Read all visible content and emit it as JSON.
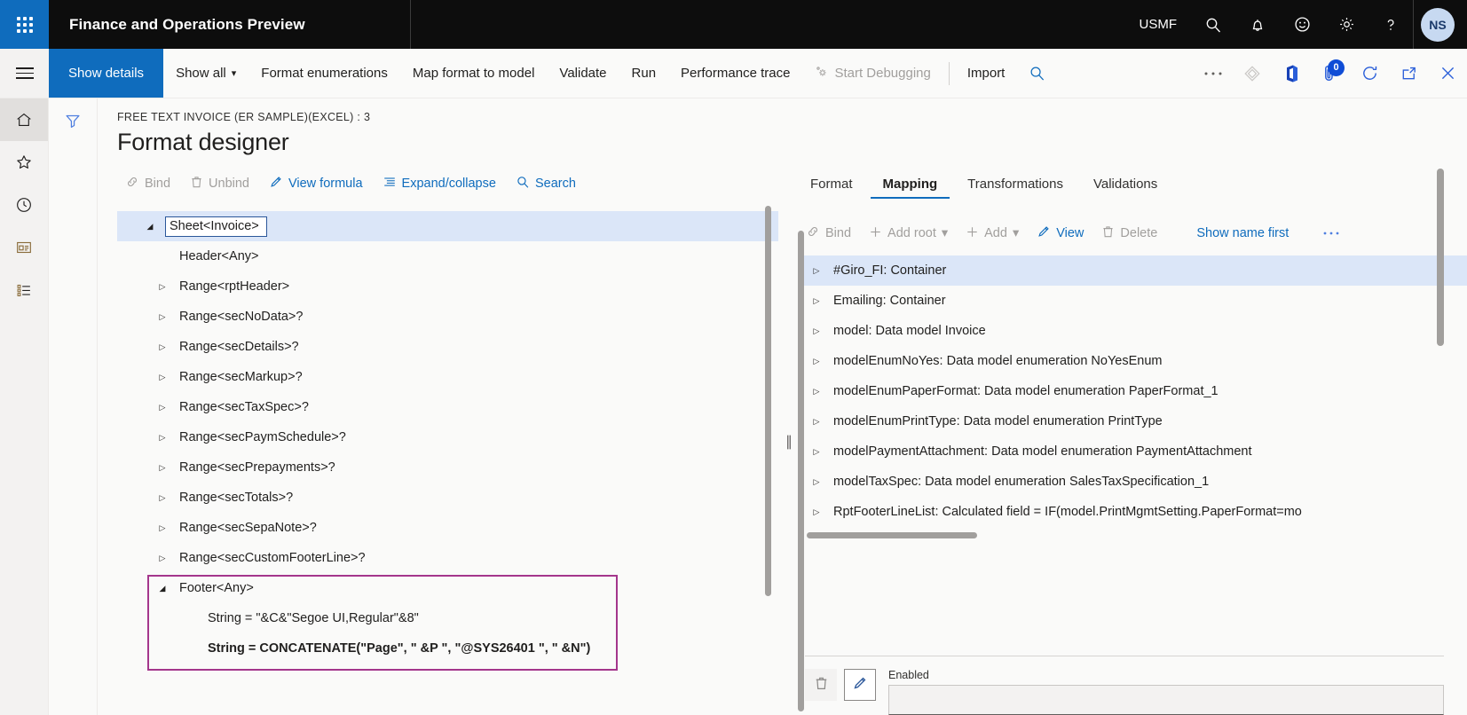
{
  "navbar": {
    "waffle_icon": "app-launcher-icon",
    "app_title": "Finance and Operations Preview",
    "company": "USMF",
    "icons": [
      "search-icon",
      "bell-icon",
      "feedback-smiley-icon",
      "gear-icon",
      "help-question-icon"
    ],
    "avatar_initials": "NS",
    "accent": "#0f6cbd",
    "bar_bg": "#0d0d0d"
  },
  "actionpane": {
    "hamburger_icon": "hamburger-menu-icon",
    "active_tab": "Show details",
    "items": [
      {
        "label": "Show all",
        "icon": "",
        "chevron": "⌵",
        "disabled": false
      },
      {
        "label": "Format enumerations",
        "icon": "",
        "chevron": "",
        "disabled": false
      },
      {
        "label": "Map format to model",
        "icon": "",
        "chevron": "",
        "disabled": false
      },
      {
        "label": "Validate",
        "icon": "",
        "chevron": "",
        "disabled": false
      },
      {
        "label": "Run",
        "icon": "",
        "chevron": "",
        "disabled": false
      },
      {
        "label": "Performance trace",
        "icon": "",
        "chevron": "",
        "disabled": false
      },
      {
        "label": "Start Debugging",
        "icon": "debug-gear-icon",
        "chevron": "",
        "disabled": true
      },
      {
        "label": "Import",
        "icon": "",
        "chevron": "",
        "disabled": false
      }
    ],
    "right_icons": [
      "search-icon",
      "ellipsis-icon",
      "diamond-lifecycle-icon",
      "office-icon",
      "attachment-icon",
      "refresh-icon",
      "open-in-new-window-icon",
      "close-icon"
    ],
    "attachment_badge": "0"
  },
  "railbar": {
    "items": [
      "home-icon",
      "favorites-star-icon",
      "recent-clock-icon",
      "workspaces-icon",
      "modules-list-icon"
    ]
  },
  "filterbar": {
    "icon": "filter-funnel-icon"
  },
  "header": {
    "breadcrumb": "FREE TEXT INVOICE (ER SAMPLE)(EXCEL) : 3",
    "title": "Format designer"
  },
  "left_pane": {
    "toolbar": [
      {
        "label": "Bind",
        "icon": "bind-link-icon",
        "disabled": true
      },
      {
        "label": "Unbind",
        "icon": "trash-icon",
        "disabled": true
      },
      {
        "label": "View formula",
        "icon": "pencil-icon",
        "disabled": false
      },
      {
        "label": "Expand/collapse",
        "icon": "list-lines-icon",
        "disabled": false
      },
      {
        "label": "Search",
        "icon": "search-icon",
        "disabled": false
      }
    ],
    "tree": [
      {
        "label": "Sheet<Invoice>",
        "twisty": "expanded",
        "indent": 0,
        "selected": true,
        "boxed": true,
        "bold": false
      },
      {
        "label": "Header<Any>",
        "twisty": "none",
        "indent": 1,
        "selected": false,
        "boxed": false,
        "bold": false
      },
      {
        "label": "Range<rptHeader>",
        "twisty": "collapsed",
        "indent": 1,
        "selected": false,
        "boxed": false,
        "bold": false
      },
      {
        "label": "Range<secNoData>?",
        "twisty": "collapsed",
        "indent": 1,
        "selected": false,
        "boxed": false,
        "bold": false
      },
      {
        "label": "Range<secDetails>?",
        "twisty": "collapsed",
        "indent": 1,
        "selected": false,
        "boxed": false,
        "bold": false
      },
      {
        "label": "Range<secMarkup>?",
        "twisty": "collapsed",
        "indent": 1,
        "selected": false,
        "boxed": false,
        "bold": false
      },
      {
        "label": "Range<secTaxSpec>?",
        "twisty": "collapsed",
        "indent": 1,
        "selected": false,
        "boxed": false,
        "bold": false
      },
      {
        "label": "Range<secPaymSchedule>?",
        "twisty": "collapsed",
        "indent": 1,
        "selected": false,
        "boxed": false,
        "bold": false
      },
      {
        "label": "Range<secPrepayments>?",
        "twisty": "collapsed",
        "indent": 1,
        "selected": false,
        "boxed": false,
        "bold": false
      },
      {
        "label": "Range<secTotals>?",
        "twisty": "collapsed",
        "indent": 1,
        "selected": false,
        "boxed": false,
        "bold": false
      },
      {
        "label": "Range<secSepaNote>?",
        "twisty": "collapsed",
        "indent": 1,
        "selected": false,
        "boxed": false,
        "bold": false
      },
      {
        "label": "Range<secCustomFooterLine>?",
        "twisty": "collapsed",
        "indent": 1,
        "selected": false,
        "boxed": false,
        "bold": false
      },
      {
        "label": "Footer<Any>",
        "twisty": "expanded",
        "indent": 1,
        "selected": false,
        "boxed": false,
        "bold": false
      },
      {
        "label": "String = \"&C&\"Segoe UI,Regular\"&8\"",
        "twisty": "none",
        "indent": 2,
        "selected": false,
        "boxed": false,
        "bold": false
      },
      {
        "label": "String = CONCATENATE(\"Page\", \" &P \", \"@SYS26401 \", \" &N\")",
        "twisty": "none",
        "indent": 2,
        "selected": false,
        "boxed": false,
        "bold": true
      }
    ],
    "highlight_color": "#a4368c"
  },
  "right_pane": {
    "tabs": [
      {
        "label": "Format",
        "active": false
      },
      {
        "label": "Mapping",
        "active": true
      },
      {
        "label": "Transformations",
        "active": false
      },
      {
        "label": "Validations",
        "active": false
      }
    ],
    "toolbar": [
      {
        "label": "Bind",
        "icon": "bind-link-icon",
        "disabled": true,
        "chevron": ""
      },
      {
        "label": "Add root",
        "icon": "plus-icon",
        "disabled": true,
        "chevron": "⌵"
      },
      {
        "label": "Add",
        "icon": "plus-icon",
        "disabled": true,
        "chevron": "⌵"
      },
      {
        "label": "View",
        "icon": "pencil-icon",
        "disabled": false,
        "chevron": ""
      },
      {
        "label": "Delete",
        "icon": "trash-icon",
        "disabled": true,
        "chevron": ""
      },
      {
        "label": "Show name first",
        "icon": "",
        "disabled": false,
        "chevron": ""
      }
    ],
    "overflow_icon": "ellipsis-icon",
    "tree": [
      {
        "label": "#Giro_FI: Container",
        "selected": true
      },
      {
        "label": "Emailing: Container",
        "selected": false
      },
      {
        "label": "model: Data model Invoice",
        "selected": false
      },
      {
        "label": "modelEnumNoYes: Data model enumeration NoYesEnum",
        "selected": false
      },
      {
        "label": "modelEnumPaperFormat: Data model enumeration PaperFormat_1",
        "selected": false
      },
      {
        "label": "modelEnumPrintType: Data model enumeration PrintType",
        "selected": false
      },
      {
        "label": "modelPaymentAttachment: Data model enumeration PaymentAttachment",
        "selected": false
      },
      {
        "label": "modelTaxSpec: Data model enumeration SalesTaxSpecification_1",
        "selected": false
      },
      {
        "label": "RptFooterLineList: Calculated field = IF(model.PrintMgmtSetting.PaperFormat=mo",
        "selected": false
      }
    ],
    "properties": {
      "delete_icon": "trash-icon",
      "edit_icon": "pencil-icon",
      "field_label": "Enabled",
      "field_value": "",
      "field_placeholder": ""
    }
  }
}
